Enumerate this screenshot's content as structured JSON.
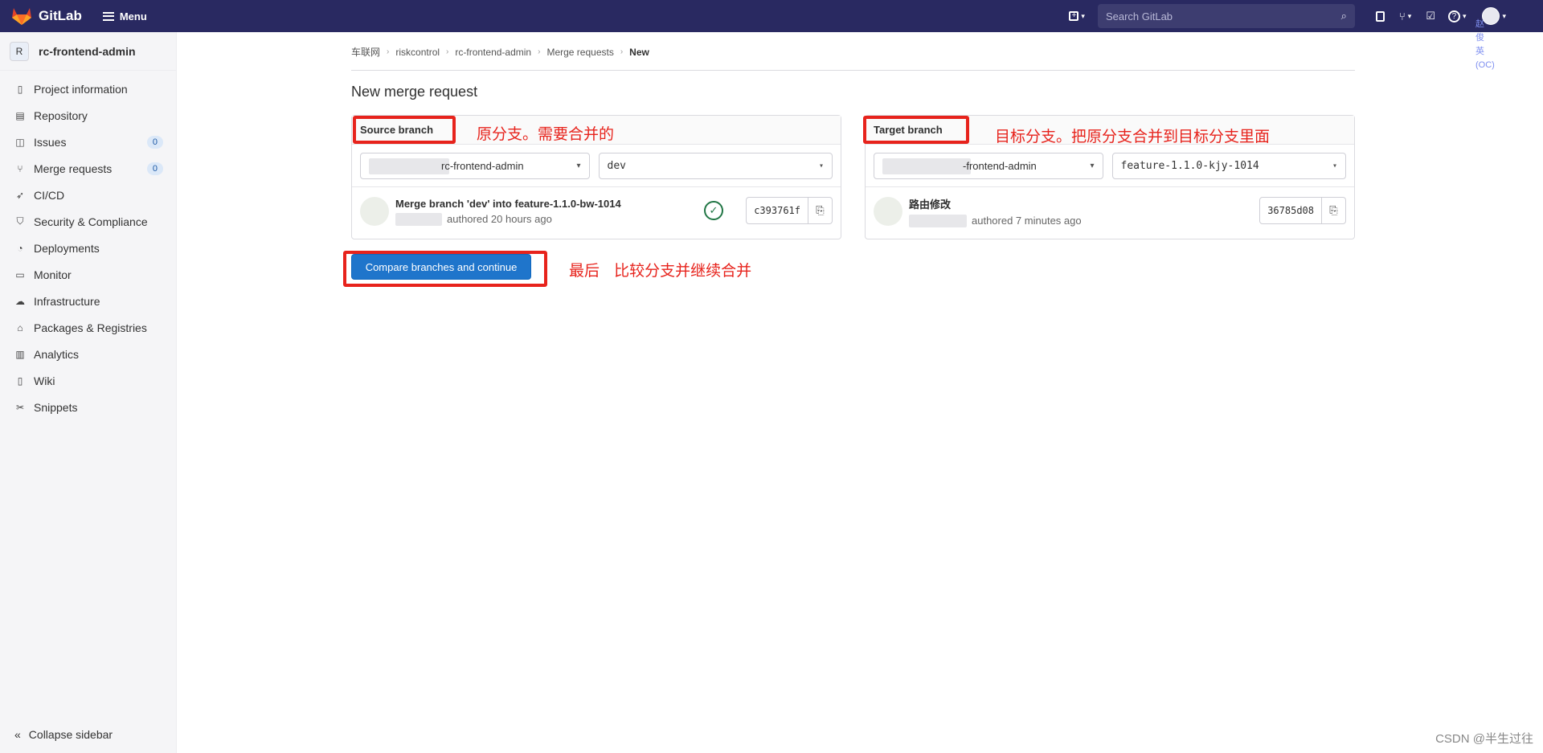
{
  "topbar": {
    "brand": "GitLab",
    "menu_label": "Menu",
    "search_placeholder": "Search GitLab",
    "user_name_fragment": [
      "赵",
      "俊",
      "英",
      "(OC)"
    ]
  },
  "sidebar": {
    "project_initial": "R",
    "project_name": "rc-frontend-admin",
    "items": [
      {
        "label": "Project information",
        "icon": "project-info-icon"
      },
      {
        "label": "Repository",
        "icon": "repository-icon"
      },
      {
        "label": "Issues",
        "icon": "issues-icon",
        "badge": "0"
      },
      {
        "label": "Merge requests",
        "icon": "merge-request-icon",
        "badge": "0"
      },
      {
        "label": "CI/CD",
        "icon": "rocket-icon"
      },
      {
        "label": "Security & Compliance",
        "icon": "shield-icon"
      },
      {
        "label": "Deployments",
        "icon": "deployments-icon"
      },
      {
        "label": "Monitor",
        "icon": "monitor-icon"
      },
      {
        "label": "Infrastructure",
        "icon": "cloud-icon"
      },
      {
        "label": "Packages & Registries",
        "icon": "package-icon"
      },
      {
        "label": "Analytics",
        "icon": "chart-icon"
      },
      {
        "label": "Wiki",
        "icon": "book-icon"
      },
      {
        "label": "Snippets",
        "icon": "scissors-icon"
      }
    ],
    "collapse_label": "Collapse sidebar"
  },
  "breadcrumb": [
    "车联网",
    "riskcontrol",
    "rc-frontend-admin",
    "Merge requests",
    "New"
  ],
  "page_title": "New merge request",
  "source": {
    "header": "Source branch",
    "project": "rc-frontend-admin",
    "branch": "dev",
    "commit_message": "Merge branch 'dev' into feature-1.1.0-bw-1014",
    "commit_meta": "authored 20 hours ago",
    "sha": "c393761f"
  },
  "target": {
    "header": "Target branch",
    "project": "-frontend-admin",
    "branch": "feature-1.1.0-kjy-1014",
    "commit_message": "路由修改",
    "commit_meta": "authored 7 minutes ago",
    "sha": "36785d08"
  },
  "compare_button": "Compare branches and continue",
  "annotations": {
    "source_note": "原分支。需要合并的",
    "target_note": "目标分支。把原分支合并到目标分支里面",
    "final_note": "最后   比较分支并继续合并",
    "color": "#e7231c"
  },
  "watermark": "CSDN @半生过往",
  "colors": {
    "topbar": "#292961",
    "primary": "#1f75cb",
    "success": "#217645"
  }
}
